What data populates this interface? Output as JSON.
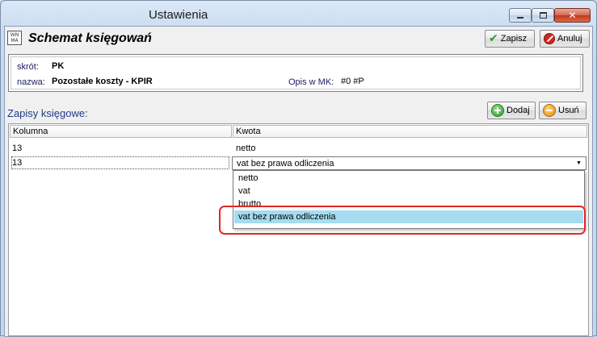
{
  "window": {
    "title": "Ustawienia"
  },
  "form": {
    "title": "Schemat księgowań",
    "app_icon_text": "WN MA"
  },
  "toolbar": {
    "save_label": "Zapisz",
    "cancel_label": "Anuluj"
  },
  "info": {
    "shortcut_label": "skrót:",
    "shortcut_value": "PK",
    "name_label": "nazwa:",
    "name_value": "Pozostałe koszty - KPIR",
    "desc_label": "Opis w MK:",
    "desc_value": "#0 #P"
  },
  "entries": {
    "section_label": "Zapisy księgowe:",
    "add_label": "Dodaj",
    "remove_label": "Usuń",
    "columns": [
      "Kolumna",
      "Kwota"
    ],
    "rows": [
      {
        "kolumna": "13",
        "kwota": "netto"
      },
      {
        "kolumna": "13",
        "kwota": "vat bez prawa odliczenia"
      }
    ],
    "dropdown_options": [
      "netto",
      "vat",
      "brutto",
      "vat bez prawa odliczenia"
    ],
    "selected_option_index": 3
  },
  "colors": {
    "highlight": "#e02828",
    "selected_row": "#a5dcf0",
    "section_label": "#1f3a86"
  }
}
